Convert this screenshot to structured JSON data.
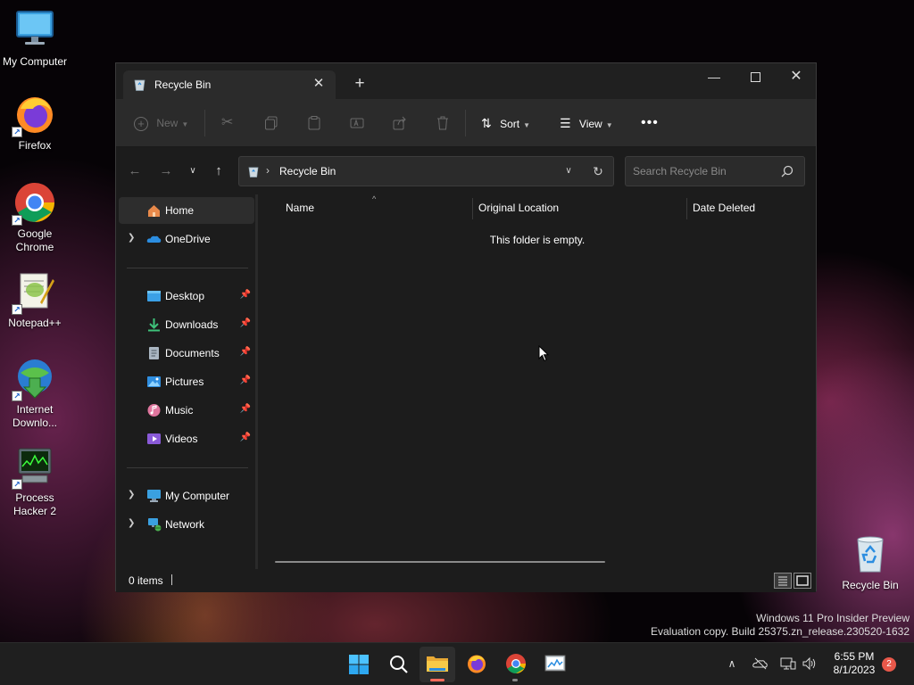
{
  "desktop": {
    "icons": [
      {
        "label": "My Computer",
        "icon": "monitor-icon"
      },
      {
        "label": "Firefox",
        "icon": "firefox-icon"
      },
      {
        "label": "Google Chrome",
        "icon": "chrome-icon"
      },
      {
        "label": "Notepad++",
        "icon": "notepad-plus-plus-icon"
      },
      {
        "label": "Internet Downlo...",
        "icon": "internet-download-manager-icon"
      },
      {
        "label": "Process Hacker 2",
        "icon": "process-hacker-icon"
      },
      {
        "label": "Recycle Bin",
        "icon": "recycle-bin-icon"
      }
    ]
  },
  "window": {
    "tab_title": "Recycle Bin",
    "toolbar": {
      "new_label": "New",
      "sort_label": "Sort",
      "view_label": "View"
    },
    "address": {
      "path": "Recycle Bin"
    },
    "search": {
      "placeholder": "Search Recycle Bin"
    },
    "sidebar": {
      "home": "Home",
      "onedrive": "OneDrive",
      "quick_access": [
        {
          "label": "Desktop",
          "icon": "desktop-folder-icon"
        },
        {
          "label": "Downloads",
          "icon": "download-arrow-icon"
        },
        {
          "label": "Documents",
          "icon": "document-icon"
        },
        {
          "label": "Pictures",
          "icon": "picture-icon"
        },
        {
          "label": "Music",
          "icon": "music-note-icon"
        },
        {
          "label": "Videos",
          "icon": "video-icon"
        }
      ],
      "my_computer": "My Computer",
      "network": "Network"
    },
    "columns": {
      "name": "Name",
      "original_location": "Original Location",
      "date_deleted": "Date Deleted"
    },
    "empty_message": "This folder is empty.",
    "status": {
      "items": "0 items"
    }
  },
  "watermark": {
    "line1": "Windows 11 Pro Insider Preview",
    "line2": "Evaluation copy. Build 25375.zn_release.230520-1632"
  },
  "taskbar": {
    "time": "6:55 PM",
    "date": "8/1/2023",
    "notification_count": "2"
  },
  "colors": {
    "window_bg": "#1c1c1c",
    "toolbar_bg": "#2b2b2b",
    "accent_folder": "#f2c14e",
    "badge": "#e8584a"
  }
}
